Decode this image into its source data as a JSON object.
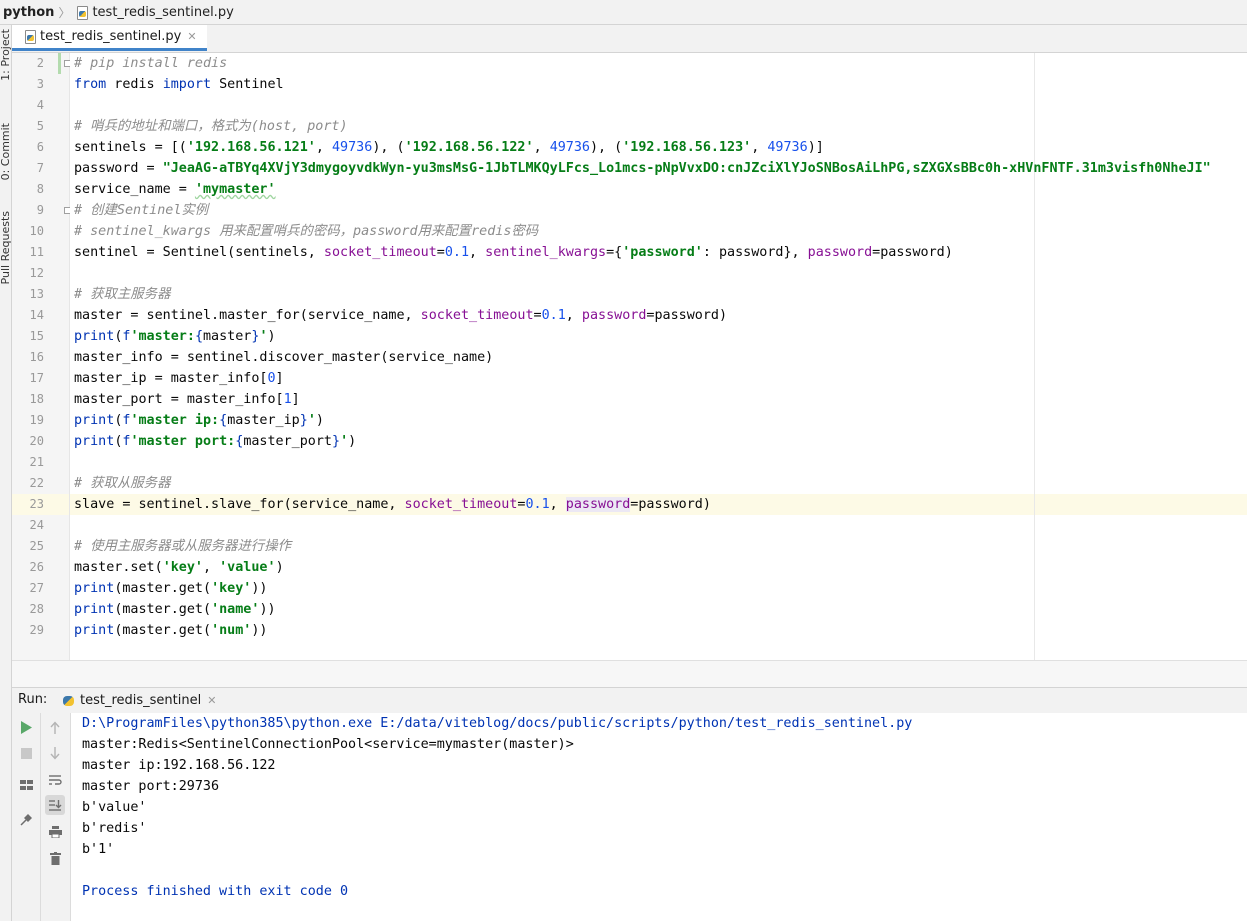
{
  "breadcrumb": {
    "project": "python",
    "file": "test_redis_sentinel.py"
  },
  "left_toolbar": {
    "project_tab": "1: Project",
    "commit_tab": "0: Commit",
    "pull_requests_tab": "Pull Requests"
  },
  "editor": {
    "tab_label": "test_redis_sentinel.py",
    "current_line": 23,
    "lines": [
      {
        "num": "2",
        "text": "# pip install redis"
      },
      {
        "num": "3",
        "text": "from redis import Sentinel"
      },
      {
        "num": "4",
        "text": ""
      },
      {
        "num": "5",
        "text": "# 哨兵的地址和端口，格式为(host, port)"
      },
      {
        "num": "6",
        "text": "sentinels = [('192.168.56.121', 49736), ('192.168.56.122', 49736), ('192.168.56.123', 49736)]"
      },
      {
        "num": "7",
        "text": "password = \"JeaAG-aTBYq4XVjY3dmygoyvdkWyn-yu3msMsG-1JbTLMKQyLFcs_Lo1mcs-pNpVvxDO:cnJZciXlYJoSNBosAiLhPG,sZXGXsBBc0h-xHVnFNTF.31m3visfh0NheJI\""
      },
      {
        "num": "8",
        "text": "service_name = 'mymaster'"
      },
      {
        "num": "9",
        "text": "# 创建Sentinel实例"
      },
      {
        "num": "10",
        "text": "# sentinel_kwargs 用来配置哨兵的密码，password用来配置redis密码"
      },
      {
        "num": "11",
        "text": "sentinel = Sentinel(sentinels, socket_timeout=0.1, sentinel_kwargs={'password': password}, password=password)"
      },
      {
        "num": "12",
        "text": ""
      },
      {
        "num": "13",
        "text": "# 获取主服务器"
      },
      {
        "num": "14",
        "text": "master = sentinel.master_for(service_name, socket_timeout=0.1, password=password)"
      },
      {
        "num": "15",
        "text": "print(f'master:{master}')"
      },
      {
        "num": "16",
        "text": "master_info = sentinel.discover_master(service_name)"
      },
      {
        "num": "17",
        "text": "master_ip = master_info[0]"
      },
      {
        "num": "18",
        "text": "master_port = master_info[1]"
      },
      {
        "num": "19",
        "text": "print(f'master ip:{master_ip}')"
      },
      {
        "num": "20",
        "text": "print(f'master port:{master_port}')"
      },
      {
        "num": "21",
        "text": ""
      },
      {
        "num": "22",
        "text": "# 获取从服务器"
      },
      {
        "num": "23",
        "text": "slave = sentinel.slave_for(service_name, socket_timeout=0.1, password=password)"
      },
      {
        "num": "24",
        "text": ""
      },
      {
        "num": "25",
        "text": "# 使用主服务器或从服务器进行操作"
      },
      {
        "num": "26",
        "text": "master.set('key', 'value')"
      },
      {
        "num": "27",
        "text": "print(master.get('key'))"
      },
      {
        "num": "28",
        "text": "print(master.get('name'))"
      },
      {
        "num": "29",
        "text": "print(master.get('num'))"
      }
    ]
  },
  "run_panel": {
    "label": "Run:",
    "tab_label": "test_redis_sentinel",
    "output": [
      "D:\\ProgramFiles\\python385\\python.exe E:/data/viteblog/docs/public/scripts/python/test_redis_sentinel.py",
      "master:Redis<SentinelConnectionPool<service=mymaster(master)>",
      "master ip:192.168.56.122",
      "master port:29736",
      "b'value'",
      "b'redis'",
      "b'1'",
      "",
      "Process finished with exit code 0"
    ]
  },
  "icons": [
    "python-file-icon",
    "fold-marker-icon",
    "run-icon",
    "stop-icon",
    "up-arrow-icon",
    "down-arrow-icon",
    "soft-wrap-icon",
    "scroll-to-end-icon",
    "print-icon",
    "trash-icon",
    "layout-icon",
    "pin-icon",
    "close-icon"
  ],
  "colors": {
    "keyword": "#0033b3",
    "string": "#067d17",
    "number": "#1750eb",
    "param": "#871094",
    "comment": "#8c8c8c",
    "current_line": "#fdfae6",
    "run_green": "#59a869"
  }
}
